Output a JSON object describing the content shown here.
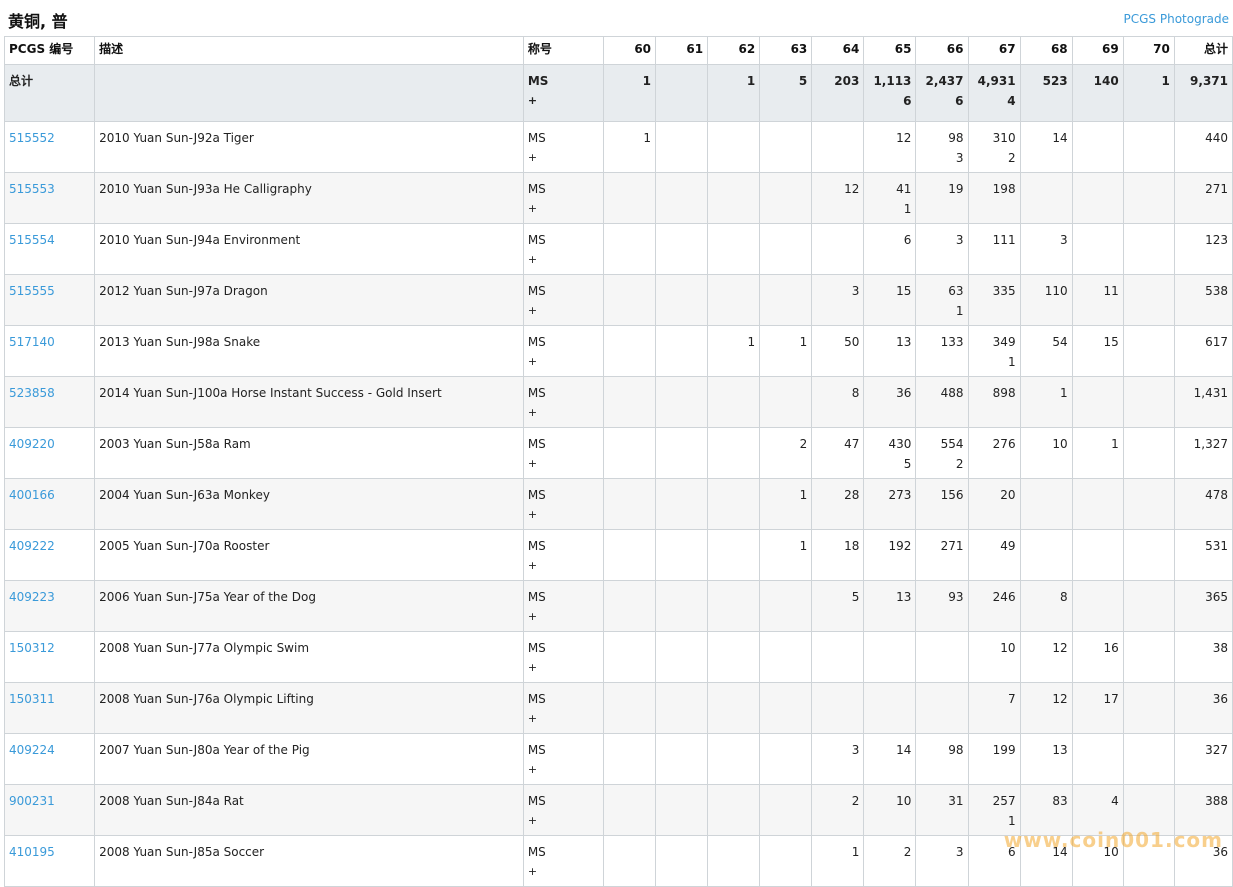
{
  "header": {
    "title": "黄铜, 普",
    "photograde_link": "PCGS Photograde"
  },
  "table": {
    "columns": {
      "pcgs_no": "PCGS 编号",
      "description": "描述",
      "designation": "称号",
      "grades": [
        "60",
        "61",
        "62",
        "63",
        "64",
        "65",
        "66",
        "67",
        "68",
        "69",
        "70"
      ],
      "total": "总计"
    },
    "total_row": {
      "label": "总计",
      "designation_line1": "MS",
      "designation_line2": "+",
      "grades": [
        {
          "v": "1",
          "s": ""
        },
        {
          "v": "",
          "s": ""
        },
        {
          "v": "1",
          "s": ""
        },
        {
          "v": "5",
          "s": ""
        },
        {
          "v": "203",
          "s": ""
        },
        {
          "v": "1,113",
          "s": "6"
        },
        {
          "v": "2,437",
          "s": "6"
        },
        {
          "v": "4,931",
          "s": "4"
        },
        {
          "v": "523",
          "s": ""
        },
        {
          "v": "140",
          "s": ""
        },
        {
          "v": "1",
          "s": ""
        }
      ],
      "total": "9,371"
    },
    "rows": [
      {
        "pcgs": "515552",
        "desc": "2010 Yuan Sun-J92a Tiger",
        "d1": "MS",
        "d2": "+",
        "g": [
          {
            "v": "1",
            "s": ""
          },
          {
            "v": "",
            "s": ""
          },
          {
            "v": "",
            "s": ""
          },
          {
            "v": "",
            "s": ""
          },
          {
            "v": "",
            "s": ""
          },
          {
            "v": "12",
            "s": ""
          },
          {
            "v": "98",
            "s": "3"
          },
          {
            "v": "310",
            "s": "2"
          },
          {
            "v": "14",
            "s": ""
          },
          {
            "v": "",
            "s": ""
          },
          {
            "v": "",
            "s": ""
          }
        ],
        "total": "440"
      },
      {
        "pcgs": "515553",
        "desc": "2010 Yuan Sun-J93a He Calligraphy",
        "d1": "MS",
        "d2": "+",
        "g": [
          {
            "v": "",
            "s": ""
          },
          {
            "v": "",
            "s": ""
          },
          {
            "v": "",
            "s": ""
          },
          {
            "v": "",
            "s": ""
          },
          {
            "v": "12",
            "s": ""
          },
          {
            "v": "41",
            "s": "1"
          },
          {
            "v": "19",
            "s": ""
          },
          {
            "v": "198",
            "s": ""
          },
          {
            "v": "",
            "s": ""
          },
          {
            "v": "",
            "s": ""
          },
          {
            "v": "",
            "s": ""
          }
        ],
        "total": "271"
      },
      {
        "pcgs": "515554",
        "desc": "2010 Yuan Sun-J94a Environment",
        "d1": "MS",
        "d2": "+",
        "g": [
          {
            "v": "",
            "s": ""
          },
          {
            "v": "",
            "s": ""
          },
          {
            "v": "",
            "s": ""
          },
          {
            "v": "",
            "s": ""
          },
          {
            "v": "",
            "s": ""
          },
          {
            "v": "6",
            "s": ""
          },
          {
            "v": "3",
            "s": ""
          },
          {
            "v": "111",
            "s": ""
          },
          {
            "v": "3",
            "s": ""
          },
          {
            "v": "",
            "s": ""
          },
          {
            "v": "",
            "s": ""
          }
        ],
        "total": "123"
      },
      {
        "pcgs": "515555",
        "desc": "2012 Yuan Sun-J97a Dragon",
        "d1": "MS",
        "d2": "+",
        "g": [
          {
            "v": "",
            "s": ""
          },
          {
            "v": "",
            "s": ""
          },
          {
            "v": "",
            "s": ""
          },
          {
            "v": "",
            "s": ""
          },
          {
            "v": "3",
            "s": ""
          },
          {
            "v": "15",
            "s": ""
          },
          {
            "v": "63",
            "s": "1"
          },
          {
            "v": "335",
            "s": ""
          },
          {
            "v": "110",
            "s": ""
          },
          {
            "v": "11",
            "s": ""
          },
          {
            "v": "",
            "s": ""
          }
        ],
        "total": "538"
      },
      {
        "pcgs": "517140",
        "desc": "2013 Yuan Sun-J98a Snake",
        "d1": "MS",
        "d2": "+",
        "g": [
          {
            "v": "",
            "s": ""
          },
          {
            "v": "",
            "s": ""
          },
          {
            "v": "1",
            "s": ""
          },
          {
            "v": "1",
            "s": ""
          },
          {
            "v": "50",
            "s": ""
          },
          {
            "v": "13",
            "s": ""
          },
          {
            "v": "133",
            "s": ""
          },
          {
            "v": "349",
            "s": "1"
          },
          {
            "v": "54",
            "s": ""
          },
          {
            "v": "15",
            "s": ""
          },
          {
            "v": "",
            "s": ""
          }
        ],
        "total": "617"
      },
      {
        "pcgs": "523858",
        "desc": "2014 Yuan Sun-J100a Horse Instant Success - Gold Insert",
        "d1": "MS",
        "d2": "+",
        "g": [
          {
            "v": "",
            "s": ""
          },
          {
            "v": "",
            "s": ""
          },
          {
            "v": "",
            "s": ""
          },
          {
            "v": "",
            "s": ""
          },
          {
            "v": "8",
            "s": ""
          },
          {
            "v": "36",
            "s": ""
          },
          {
            "v": "488",
            "s": ""
          },
          {
            "v": "898",
            "s": ""
          },
          {
            "v": "1",
            "s": ""
          },
          {
            "v": "",
            "s": ""
          },
          {
            "v": "",
            "s": ""
          }
        ],
        "total": "1,431"
      },
      {
        "pcgs": "409220",
        "desc": "2003 Yuan Sun-J58a Ram",
        "d1": "MS",
        "d2": "+",
        "g": [
          {
            "v": "",
            "s": ""
          },
          {
            "v": "",
            "s": ""
          },
          {
            "v": "",
            "s": ""
          },
          {
            "v": "2",
            "s": ""
          },
          {
            "v": "47",
            "s": ""
          },
          {
            "v": "430",
            "s": "5"
          },
          {
            "v": "554",
            "s": "2"
          },
          {
            "v": "276",
            "s": ""
          },
          {
            "v": "10",
            "s": ""
          },
          {
            "v": "1",
            "s": ""
          },
          {
            "v": "",
            "s": ""
          }
        ],
        "total": "1,327"
      },
      {
        "pcgs": "400166",
        "desc": "2004 Yuan Sun-J63a Monkey",
        "d1": "MS",
        "d2": "+",
        "g": [
          {
            "v": "",
            "s": ""
          },
          {
            "v": "",
            "s": ""
          },
          {
            "v": "",
            "s": ""
          },
          {
            "v": "1",
            "s": ""
          },
          {
            "v": "28",
            "s": ""
          },
          {
            "v": "273",
            "s": ""
          },
          {
            "v": "156",
            "s": ""
          },
          {
            "v": "20",
            "s": ""
          },
          {
            "v": "",
            "s": ""
          },
          {
            "v": "",
            "s": ""
          },
          {
            "v": "",
            "s": ""
          }
        ],
        "total": "478"
      },
      {
        "pcgs": "409222",
        "desc": "2005 Yuan Sun-J70a Rooster",
        "d1": "MS",
        "d2": "+",
        "g": [
          {
            "v": "",
            "s": ""
          },
          {
            "v": "",
            "s": ""
          },
          {
            "v": "",
            "s": ""
          },
          {
            "v": "1",
            "s": ""
          },
          {
            "v": "18",
            "s": ""
          },
          {
            "v": "192",
            "s": ""
          },
          {
            "v": "271",
            "s": ""
          },
          {
            "v": "49",
            "s": ""
          },
          {
            "v": "",
            "s": ""
          },
          {
            "v": "",
            "s": ""
          },
          {
            "v": "",
            "s": ""
          }
        ],
        "total": "531"
      },
      {
        "pcgs": "409223",
        "desc": "2006 Yuan Sun-J75a Year of the Dog",
        "d1": "MS",
        "d2": "+",
        "g": [
          {
            "v": "",
            "s": ""
          },
          {
            "v": "",
            "s": ""
          },
          {
            "v": "",
            "s": ""
          },
          {
            "v": "",
            "s": ""
          },
          {
            "v": "5",
            "s": ""
          },
          {
            "v": "13",
            "s": ""
          },
          {
            "v": "93",
            "s": ""
          },
          {
            "v": "246",
            "s": ""
          },
          {
            "v": "8",
            "s": ""
          },
          {
            "v": "",
            "s": ""
          },
          {
            "v": "",
            "s": ""
          }
        ],
        "total": "365"
      },
      {
        "pcgs": "150312",
        "desc": "2008 Yuan Sun-J77a Olympic Swim",
        "d1": "MS",
        "d2": "+",
        "g": [
          {
            "v": "",
            "s": ""
          },
          {
            "v": "",
            "s": ""
          },
          {
            "v": "",
            "s": ""
          },
          {
            "v": "",
            "s": ""
          },
          {
            "v": "",
            "s": ""
          },
          {
            "v": "",
            "s": ""
          },
          {
            "v": "",
            "s": ""
          },
          {
            "v": "10",
            "s": ""
          },
          {
            "v": "12",
            "s": ""
          },
          {
            "v": "16",
            "s": ""
          },
          {
            "v": "",
            "s": ""
          }
        ],
        "total": "38"
      },
      {
        "pcgs": "150311",
        "desc": "2008 Yuan Sun-J76a Olympic Lifting",
        "d1": "MS",
        "d2": "+",
        "g": [
          {
            "v": "",
            "s": ""
          },
          {
            "v": "",
            "s": ""
          },
          {
            "v": "",
            "s": ""
          },
          {
            "v": "",
            "s": ""
          },
          {
            "v": "",
            "s": ""
          },
          {
            "v": "",
            "s": ""
          },
          {
            "v": "",
            "s": ""
          },
          {
            "v": "7",
            "s": ""
          },
          {
            "v": "12",
            "s": ""
          },
          {
            "v": "17",
            "s": ""
          },
          {
            "v": "",
            "s": ""
          }
        ],
        "total": "36"
      },
      {
        "pcgs": "409224",
        "desc": "2007 Yuan Sun-J80a Year of the Pig",
        "d1": "MS",
        "d2": "+",
        "g": [
          {
            "v": "",
            "s": ""
          },
          {
            "v": "",
            "s": ""
          },
          {
            "v": "",
            "s": ""
          },
          {
            "v": "",
            "s": ""
          },
          {
            "v": "3",
            "s": ""
          },
          {
            "v": "14",
            "s": ""
          },
          {
            "v": "98",
            "s": ""
          },
          {
            "v": "199",
            "s": ""
          },
          {
            "v": "13",
            "s": ""
          },
          {
            "v": "",
            "s": ""
          },
          {
            "v": "",
            "s": ""
          }
        ],
        "total": "327"
      },
      {
        "pcgs": "900231",
        "desc": "2008 Yuan Sun-J84a Rat",
        "d1": "MS",
        "d2": "+",
        "g": [
          {
            "v": "",
            "s": ""
          },
          {
            "v": "",
            "s": ""
          },
          {
            "v": "",
            "s": ""
          },
          {
            "v": "",
            "s": ""
          },
          {
            "v": "2",
            "s": ""
          },
          {
            "v": "10",
            "s": ""
          },
          {
            "v": "31",
            "s": ""
          },
          {
            "v": "257",
            "s": "1"
          },
          {
            "v": "83",
            "s": ""
          },
          {
            "v": "4",
            "s": ""
          },
          {
            "v": "",
            "s": ""
          }
        ],
        "total": "388"
      },
      {
        "pcgs": "410195",
        "desc": "2008 Yuan Sun-J85a Soccer",
        "d1": "MS",
        "d2": "+",
        "g": [
          {
            "v": "",
            "s": ""
          },
          {
            "v": "",
            "s": ""
          },
          {
            "v": "",
            "s": ""
          },
          {
            "v": "",
            "s": ""
          },
          {
            "v": "1",
            "s": ""
          },
          {
            "v": "2",
            "s": ""
          },
          {
            "v": "3",
            "s": ""
          },
          {
            "v": "6",
            "s": ""
          },
          {
            "v": "14",
            "s": ""
          },
          {
            "v": "10",
            "s": ""
          },
          {
            "v": "",
            "s": ""
          }
        ],
        "total": "36"
      }
    ]
  },
  "watermark": "www.coin001.com",
  "colors": {
    "link": "#3a9ad9",
    "total_row_bg": "#e8ecef",
    "border": "#cfd4d8",
    "watermark": "#f3a72e"
  }
}
